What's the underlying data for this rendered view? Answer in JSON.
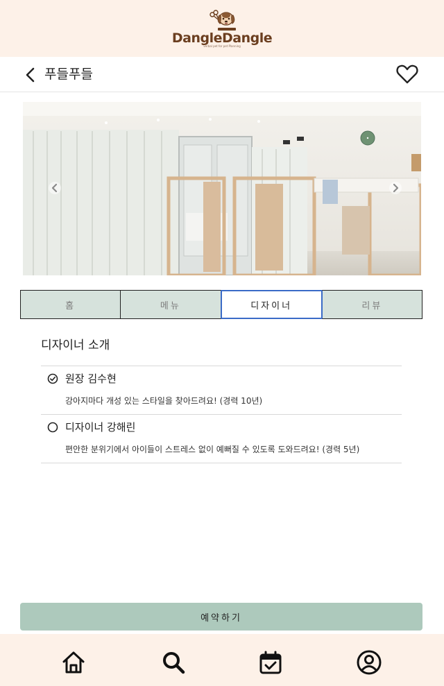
{
  "brand": {
    "name": "DangleDangle",
    "tagline": "verbal pet for pet Planning"
  },
  "nav": {
    "title": "푸들푸들",
    "back_icon": "chevron-left-icon",
    "favorite_icon": "heart-outline-icon"
  },
  "carousel": {
    "prev_icon": "chevron-left-circle-icon",
    "next_icon": "chevron-right-circle-icon"
  },
  "tabs": [
    {
      "label": "홈",
      "active": false
    },
    {
      "label": "메뉴",
      "active": false
    },
    {
      "label": "디자이너",
      "active": true
    },
    {
      "label": "리뷰",
      "active": false
    }
  ],
  "designer_section": {
    "title": "디자이너 소개",
    "designers": [
      {
        "name": "원장 김수현",
        "description": "강아지마다 개성 있는 스타일을 찾아드려요! (경력 10년)",
        "selected": true
      },
      {
        "name": "디자이너 강해린",
        "description": "편안한 분위기에서 아이들이 스트레스 없이 예뻐질 수 있도록 도와드려요! (경력 5년)",
        "selected": false
      }
    ]
  },
  "reserve_button": {
    "label": "예약하기"
  },
  "bottom_nav": [
    {
      "icon": "home-icon"
    },
    {
      "icon": "search-icon"
    },
    {
      "icon": "calendar-check-icon"
    },
    {
      "icon": "user-circle-icon"
    }
  ],
  "colors": {
    "header_bg": "#fdf1e8",
    "tab_bg": "#d6e2dc",
    "tab_active_border": "#3a6bc7",
    "reserve_bg": "#adc9bc",
    "brand_brown": "#6b3e1f"
  }
}
